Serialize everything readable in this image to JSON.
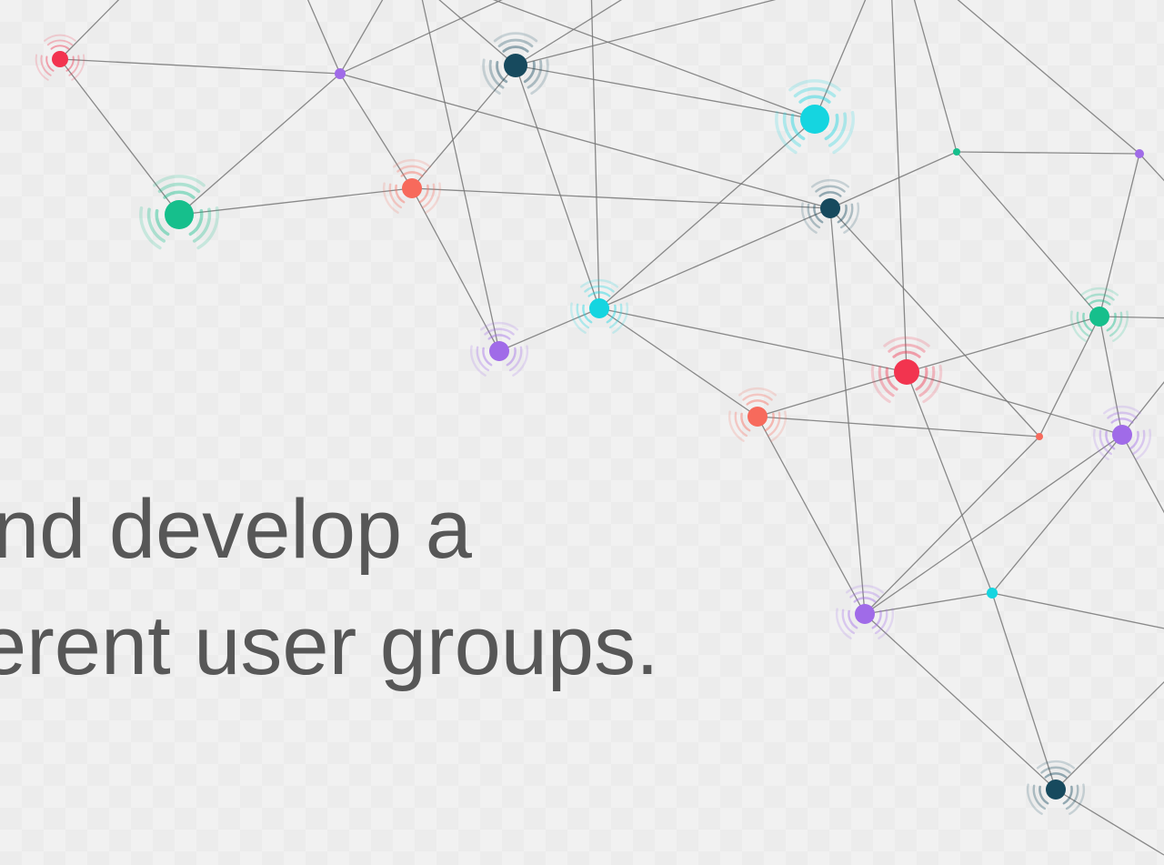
{
  "slide": {
    "text_line_1": "nd develop a",
    "text_line_2": "erent user groups."
  },
  "palette": {
    "text": "#575757",
    "background": "#f1f1f1",
    "edge": "#777777",
    "red": "#f2344f",
    "purple": "#a06be8",
    "navy": "#174a5e",
    "cyan": "#15d5e0",
    "green": "#16bf8c",
    "coral": "#f76a5c"
  }
}
